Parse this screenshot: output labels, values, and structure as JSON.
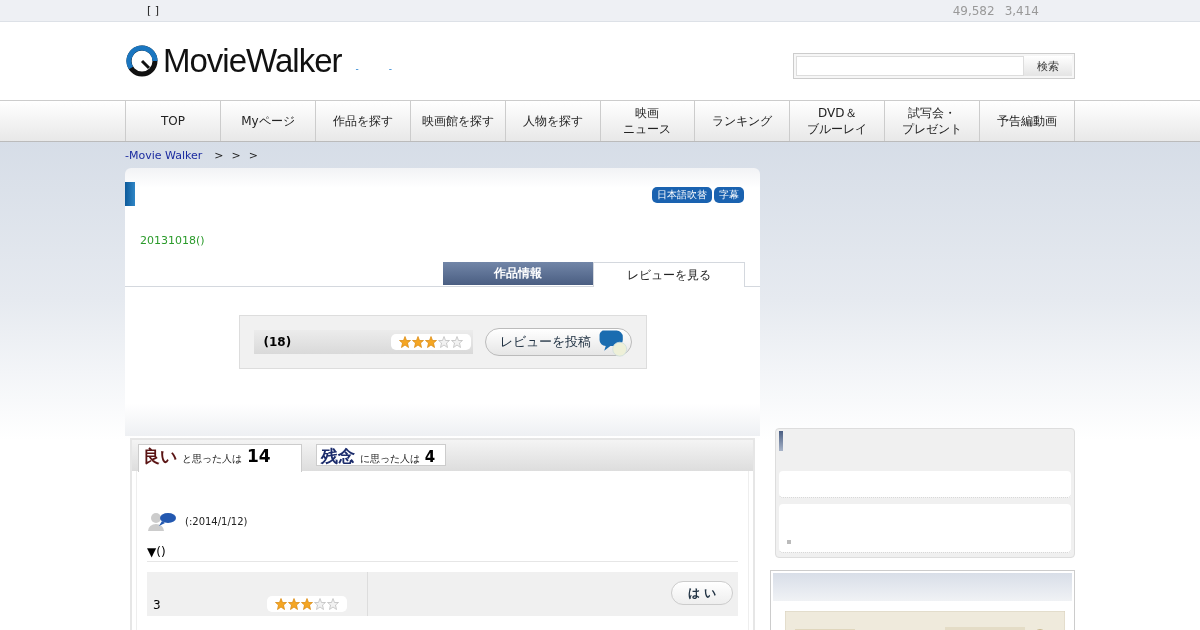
{
  "top_bar": {
    "left": "[ ]",
    "counts": [
      "49,582",
      "3,414"
    ]
  },
  "header": {
    "logo": "MovieWalker",
    "links": [
      "-",
      "-"
    ],
    "search": {
      "button": "検索"
    }
  },
  "nav": [
    {
      "lines": [
        "TOP"
      ]
    },
    {
      "lines": [
        "Myページ"
      ]
    },
    {
      "lines": [
        "作品を探す"
      ]
    },
    {
      "lines": [
        "映画館を探す"
      ]
    },
    {
      "lines": [
        "人物を探す"
      ]
    },
    {
      "lines": [
        "映画",
        "ニュース"
      ]
    },
    {
      "lines": [
        "ランキング"
      ]
    },
    {
      "lines": [
        "DVD＆",
        "ブルーレイ"
      ]
    },
    {
      "lines": [
        "試写会・",
        "プレゼント"
      ]
    },
    {
      "lines": [
        "予告編動画"
      ]
    }
  ],
  "breadcrumb": {
    "link": "-Movie Walker",
    "separators": [
      ">",
      ">",
      ">"
    ]
  },
  "movie": {
    "badges": [
      "日本語吹替",
      "字幕"
    ],
    "date": "20131018()",
    "tabs": [
      {
        "label": "作品情報",
        "selected": false
      },
      {
        "label": "レビューを見る",
        "selected": true
      }
    ]
  },
  "summary": {
    "count": "(18)",
    "stars": 3,
    "post_button": "レビューを投稿"
  },
  "vote_tabs": [
    {
      "word": "良い",
      "suffix": "と思った人は",
      "count": "14",
      "selected": true,
      "color": "#5a1414"
    },
    {
      "word": "残念",
      "suffix": "に思った人は",
      "count": "4",
      "selected": false,
      "color": "#1c2c6c"
    }
  ],
  "review": {
    "date": "(:2014/1/12)",
    "toggle": "▼()",
    "score": "3",
    "stars": 3,
    "button": "は い"
  }
}
